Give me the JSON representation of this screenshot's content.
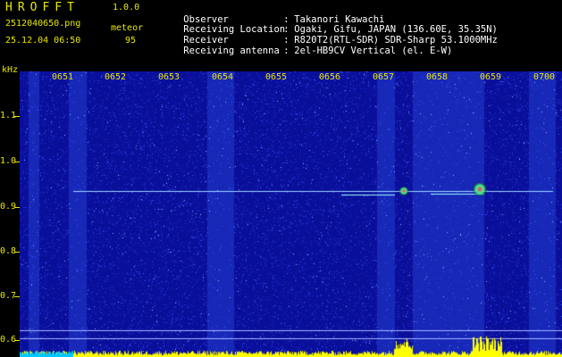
{
  "app": {
    "title": "HROFFT",
    "version": "1.0.0",
    "file_name": "2512040650.png",
    "timestamp": "25.12.04 06:50",
    "meteor_label": "meteor",
    "meteor_count": "95"
  },
  "info": [
    {
      "key": "Observer",
      "sep": ":",
      "value": "Takanori Kawachi"
    },
    {
      "key": "Receiving Location",
      "sep": ":",
      "value": "Ogaki, Gifu, JAPAN (136.60E, 35.35N)"
    },
    {
      "key": "Receiver",
      "sep": ":",
      "value": "R820T2(RTL-SDR) SDR-Sharp 53.1000MHz"
    },
    {
      "key": "Receiving antenna",
      "sep": ":",
      "value": "2el-HB9CV Vertical (el. E-W)"
    }
  ],
  "spectrogram": {
    "y_unit": "kHz",
    "y_ticks": [
      "1.1",
      "1.0",
      "0.9",
      "0.8",
      "0.7",
      "0.6"
    ],
    "x_ticks": [
      "0651",
      "0652",
      "0653",
      "0654",
      "0655",
      "0656",
      "0657",
      "0658",
      "0659",
      "0700"
    ],
    "colors": {
      "background": "#0a0f9a",
      "noise": "#3a5cff",
      "carrier": "#9fd8ff",
      "label": "#e8e800",
      "meteor_hot": "#ff3060",
      "activity": "#ffff00",
      "baseline": "#00c8ff"
    }
  }
}
